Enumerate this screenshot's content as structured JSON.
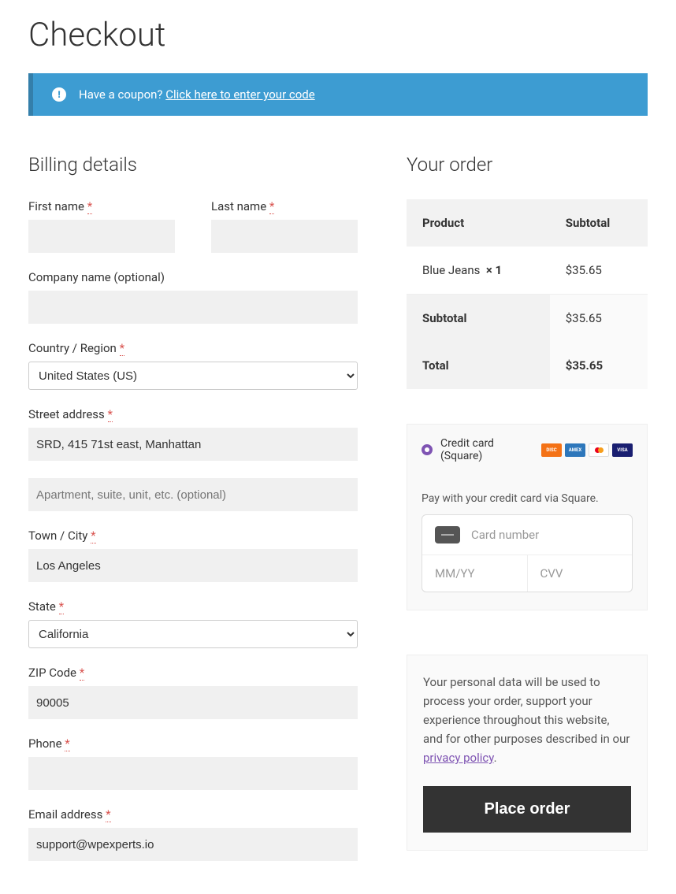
{
  "page_title": "Checkout",
  "coupon_notice": {
    "prefix": "Have a coupon?",
    "link": "Click here to enter your code"
  },
  "billing": {
    "heading": "Billing details",
    "first_name": {
      "label": "First name",
      "value": ""
    },
    "last_name": {
      "label": "Last name",
      "value": ""
    },
    "company": {
      "label": "Company name (optional)",
      "value": ""
    },
    "country": {
      "label": "Country / Region",
      "value": "United States (US)"
    },
    "address1": {
      "label": "Street address",
      "value": "SRD, 415 71st east, Manhattan"
    },
    "address2": {
      "placeholder": "Apartment, suite, unit, etc. (optional)",
      "value": ""
    },
    "city": {
      "label": "Town / City",
      "value": "Los Angeles"
    },
    "state": {
      "label": "State",
      "value": "California"
    },
    "zip": {
      "label": "ZIP Code",
      "value": "90005"
    },
    "phone": {
      "label": "Phone",
      "value": ""
    },
    "email": {
      "label": "Email address",
      "value": "support@wpexperts.io"
    }
  },
  "order": {
    "heading": "Your order",
    "headers": {
      "product": "Product",
      "subtotal": "Subtotal"
    },
    "item": {
      "name": "Blue Jeans",
      "qty": "× 1",
      "price": "$35.65"
    },
    "subtotal": {
      "label": "Subtotal",
      "value": "$35.65"
    },
    "total": {
      "label": "Total",
      "value": "$35.65"
    }
  },
  "payment": {
    "method": "Credit card (Square)",
    "description": "Pay with your credit card via Square.",
    "card_number_placeholder": "Card number",
    "expiry_placeholder": "MM/YY",
    "cvv_placeholder": "CVV"
  },
  "privacy": {
    "text": "Your personal data will be used to process your order, support your experience throughout this website, and for other purposes described in our ",
    "link": "privacy policy"
  },
  "place_order": "Place order",
  "req": "*"
}
